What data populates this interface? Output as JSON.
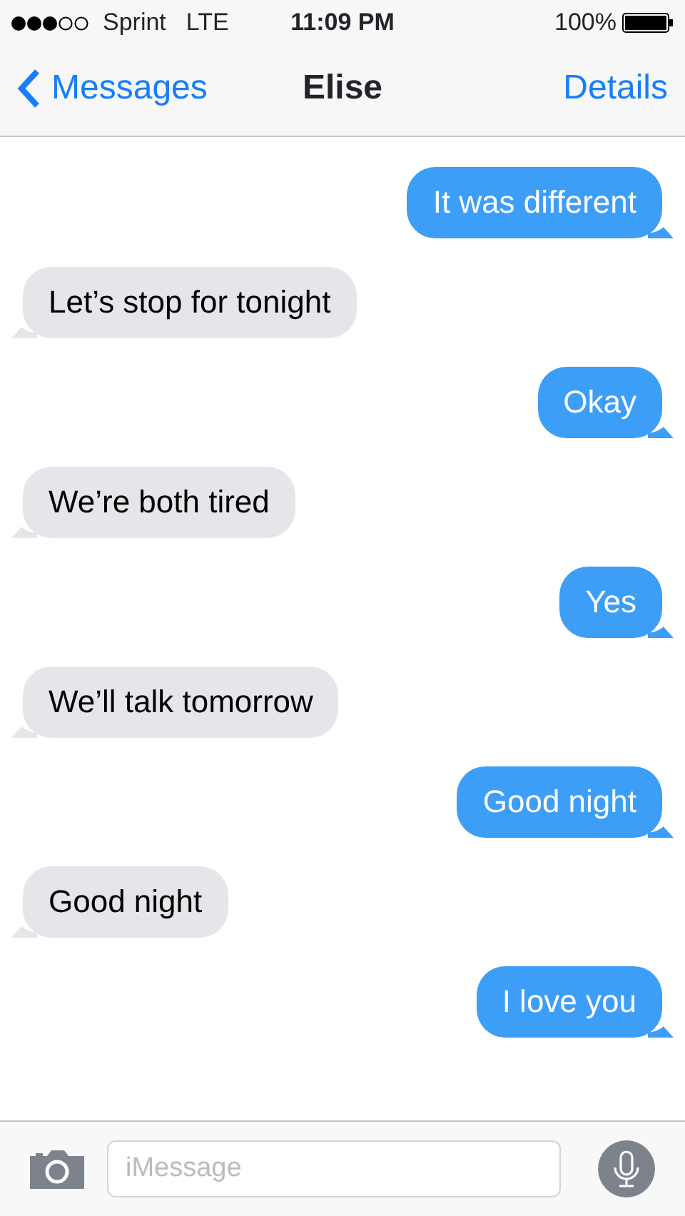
{
  "status_bar": {
    "carrier": "Sprint",
    "network": "LTE",
    "time": "11:09 PM",
    "battery": "100%"
  },
  "nav": {
    "back": "Messages",
    "title": "Elise",
    "action": "Details"
  },
  "messages": [
    {
      "kind": "sent",
      "text": "It was different"
    },
    {
      "kind": "received",
      "text": "Let’s stop for tonight"
    },
    {
      "kind": "sent",
      "text": "Okay"
    },
    {
      "kind": "received",
      "text": "We’re both tired"
    },
    {
      "kind": "sent",
      "text": "Yes"
    },
    {
      "kind": "received",
      "text": "We’ll talk tomorrow"
    },
    {
      "kind": "sent",
      "text": "Good night"
    },
    {
      "kind": "received",
      "text": "Good night"
    },
    {
      "kind": "sent",
      "text": "I love you"
    }
  ],
  "compose": {
    "placeholder": "iMessage"
  }
}
